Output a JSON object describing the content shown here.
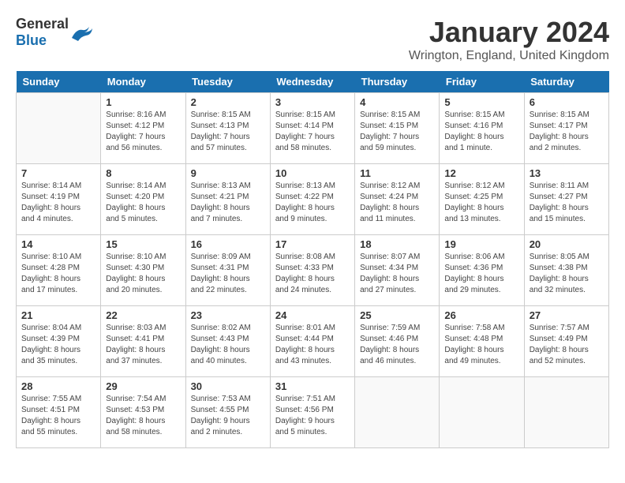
{
  "logo": {
    "general": "General",
    "blue": "Blue"
  },
  "title": "January 2024",
  "location": "Wrington, England, United Kingdom",
  "days_header": [
    "Sunday",
    "Monday",
    "Tuesday",
    "Wednesday",
    "Thursday",
    "Friday",
    "Saturday"
  ],
  "weeks": [
    [
      {
        "day": "",
        "info": ""
      },
      {
        "day": "1",
        "info": "Sunrise: 8:16 AM\nSunset: 4:12 PM\nDaylight: 7 hours\nand 56 minutes."
      },
      {
        "day": "2",
        "info": "Sunrise: 8:15 AM\nSunset: 4:13 PM\nDaylight: 7 hours\nand 57 minutes."
      },
      {
        "day": "3",
        "info": "Sunrise: 8:15 AM\nSunset: 4:14 PM\nDaylight: 7 hours\nand 58 minutes."
      },
      {
        "day": "4",
        "info": "Sunrise: 8:15 AM\nSunset: 4:15 PM\nDaylight: 7 hours\nand 59 minutes."
      },
      {
        "day": "5",
        "info": "Sunrise: 8:15 AM\nSunset: 4:16 PM\nDaylight: 8 hours\nand 1 minute."
      },
      {
        "day": "6",
        "info": "Sunrise: 8:15 AM\nSunset: 4:17 PM\nDaylight: 8 hours\nand 2 minutes."
      }
    ],
    [
      {
        "day": "7",
        "info": "Sunrise: 8:14 AM\nSunset: 4:19 PM\nDaylight: 8 hours\nand 4 minutes."
      },
      {
        "day": "8",
        "info": "Sunrise: 8:14 AM\nSunset: 4:20 PM\nDaylight: 8 hours\nand 5 minutes."
      },
      {
        "day": "9",
        "info": "Sunrise: 8:13 AM\nSunset: 4:21 PM\nDaylight: 8 hours\nand 7 minutes."
      },
      {
        "day": "10",
        "info": "Sunrise: 8:13 AM\nSunset: 4:22 PM\nDaylight: 8 hours\nand 9 minutes."
      },
      {
        "day": "11",
        "info": "Sunrise: 8:12 AM\nSunset: 4:24 PM\nDaylight: 8 hours\nand 11 minutes."
      },
      {
        "day": "12",
        "info": "Sunrise: 8:12 AM\nSunset: 4:25 PM\nDaylight: 8 hours\nand 13 minutes."
      },
      {
        "day": "13",
        "info": "Sunrise: 8:11 AM\nSunset: 4:27 PM\nDaylight: 8 hours\nand 15 minutes."
      }
    ],
    [
      {
        "day": "14",
        "info": "Sunrise: 8:10 AM\nSunset: 4:28 PM\nDaylight: 8 hours\nand 17 minutes."
      },
      {
        "day": "15",
        "info": "Sunrise: 8:10 AM\nSunset: 4:30 PM\nDaylight: 8 hours\nand 20 minutes."
      },
      {
        "day": "16",
        "info": "Sunrise: 8:09 AM\nSunset: 4:31 PM\nDaylight: 8 hours\nand 22 minutes."
      },
      {
        "day": "17",
        "info": "Sunrise: 8:08 AM\nSunset: 4:33 PM\nDaylight: 8 hours\nand 24 minutes."
      },
      {
        "day": "18",
        "info": "Sunrise: 8:07 AM\nSunset: 4:34 PM\nDaylight: 8 hours\nand 27 minutes."
      },
      {
        "day": "19",
        "info": "Sunrise: 8:06 AM\nSunset: 4:36 PM\nDaylight: 8 hours\nand 29 minutes."
      },
      {
        "day": "20",
        "info": "Sunrise: 8:05 AM\nSunset: 4:38 PM\nDaylight: 8 hours\nand 32 minutes."
      }
    ],
    [
      {
        "day": "21",
        "info": "Sunrise: 8:04 AM\nSunset: 4:39 PM\nDaylight: 8 hours\nand 35 minutes."
      },
      {
        "day": "22",
        "info": "Sunrise: 8:03 AM\nSunset: 4:41 PM\nDaylight: 8 hours\nand 37 minutes."
      },
      {
        "day": "23",
        "info": "Sunrise: 8:02 AM\nSunset: 4:43 PM\nDaylight: 8 hours\nand 40 minutes."
      },
      {
        "day": "24",
        "info": "Sunrise: 8:01 AM\nSunset: 4:44 PM\nDaylight: 8 hours\nand 43 minutes."
      },
      {
        "day": "25",
        "info": "Sunrise: 7:59 AM\nSunset: 4:46 PM\nDaylight: 8 hours\nand 46 minutes."
      },
      {
        "day": "26",
        "info": "Sunrise: 7:58 AM\nSunset: 4:48 PM\nDaylight: 8 hours\nand 49 minutes."
      },
      {
        "day": "27",
        "info": "Sunrise: 7:57 AM\nSunset: 4:49 PM\nDaylight: 8 hours\nand 52 minutes."
      }
    ],
    [
      {
        "day": "28",
        "info": "Sunrise: 7:55 AM\nSunset: 4:51 PM\nDaylight: 8 hours\nand 55 minutes."
      },
      {
        "day": "29",
        "info": "Sunrise: 7:54 AM\nSunset: 4:53 PM\nDaylight: 8 hours\nand 58 minutes."
      },
      {
        "day": "30",
        "info": "Sunrise: 7:53 AM\nSunset: 4:55 PM\nDaylight: 9 hours\nand 2 minutes."
      },
      {
        "day": "31",
        "info": "Sunrise: 7:51 AM\nSunset: 4:56 PM\nDaylight: 9 hours\nand 5 minutes."
      },
      {
        "day": "",
        "info": ""
      },
      {
        "day": "",
        "info": ""
      },
      {
        "day": "",
        "info": ""
      }
    ]
  ]
}
